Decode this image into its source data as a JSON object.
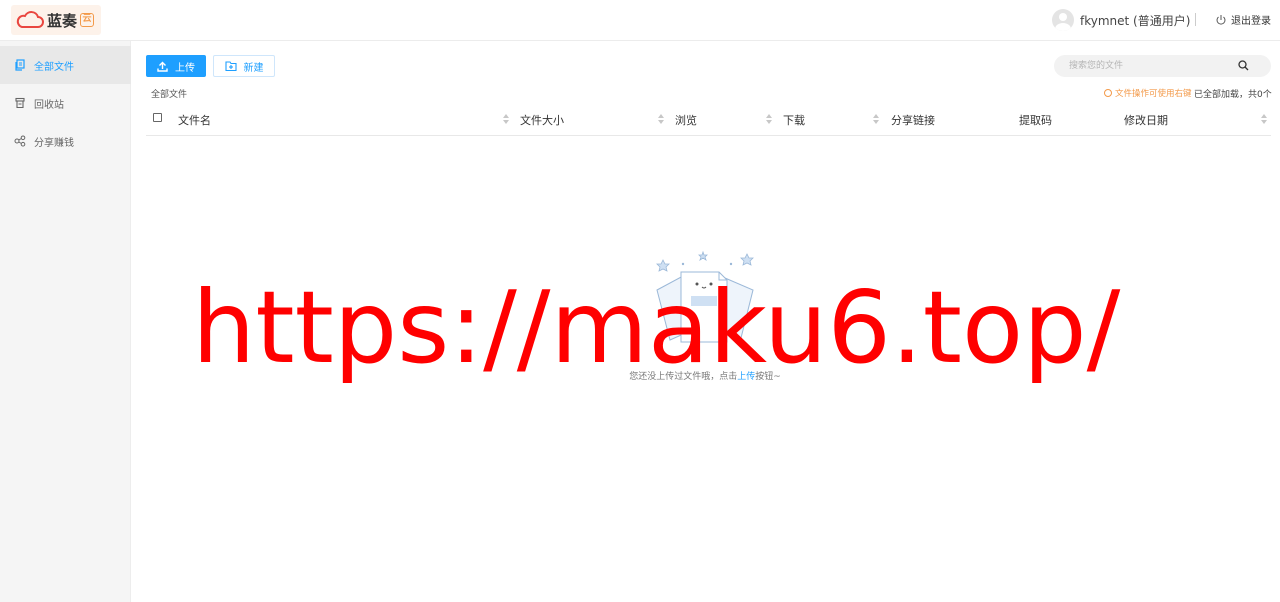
{
  "header": {
    "logo_text": "蓝奏",
    "logo_badge": "云",
    "username": "fkymnet (普通用户)",
    "logout_label": "退出登录"
  },
  "sidebar": {
    "items": [
      {
        "label": "全部文件",
        "icon": "files-icon",
        "active": true
      },
      {
        "label": "回收站",
        "icon": "trash-icon",
        "active": false
      },
      {
        "label": "分享赚钱",
        "icon": "share-icon",
        "active": false
      }
    ]
  },
  "toolbar": {
    "upload_label": "上传",
    "new_label": "新建",
    "search_placeholder": "搜索您的文件"
  },
  "breadcrumb": "全部文件",
  "status": {
    "hint": "文件操作可使用右键",
    "loaded": "已全部加载，共0个"
  },
  "table": {
    "columns": [
      "文件名",
      "文件大小",
      "浏览",
      "下载",
      "分享链接",
      "提取码",
      "修改日期"
    ]
  },
  "empty": {
    "text_before": "您还没上传过文件哦，点击",
    "link": "上传",
    "text_after": "按钮~"
  },
  "watermark": "https://maku6.top/",
  "colors": {
    "accent": "#1e9fff",
    "warning": "#f39a4a",
    "watermark": "#ff0000"
  }
}
